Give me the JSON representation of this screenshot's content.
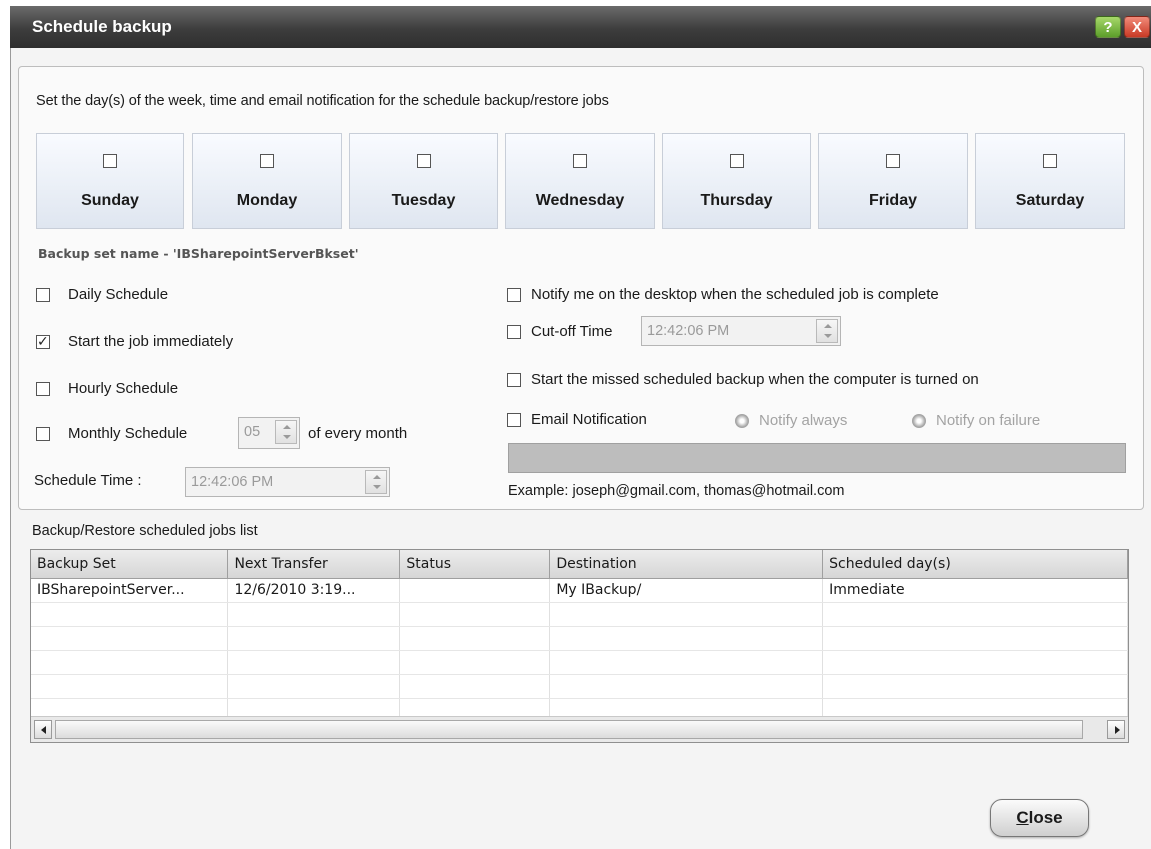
{
  "window": {
    "title": "Schedule backup",
    "help_label": "?",
    "close_label": "X"
  },
  "instruction": "Set the day(s) of the week, time and email notification for the schedule backup/restore jobs",
  "days": [
    {
      "label": "Sunday",
      "checked": false
    },
    {
      "label": "Monday",
      "checked": false
    },
    {
      "label": "Tuesday",
      "checked": false
    },
    {
      "label": "Wednesday",
      "checked": false
    },
    {
      "label": "Thursday",
      "checked": false
    },
    {
      "label": "Friday",
      "checked": false
    },
    {
      "label": "Saturday",
      "checked": false
    }
  ],
  "backup_set_name": "Backup set name - 'IBSharepointServerBkset'",
  "left_options": {
    "daily": {
      "label": "Daily Schedule",
      "checked": false
    },
    "immediate": {
      "label": "Start the job immediately",
      "checked": true
    },
    "hourly": {
      "label": "Hourly Schedule",
      "checked": false
    },
    "monthly": {
      "label": "Monthly Schedule",
      "checked": false,
      "day_value": "05",
      "suffix": "of every month"
    },
    "schedule_time": {
      "label": "Schedule Time :",
      "value": "12:42:06 PM"
    }
  },
  "right_options": {
    "notify_desktop": {
      "label": "Notify me on the desktop when the scheduled job is complete",
      "checked": false
    },
    "cutoff": {
      "label": "Cut-off Time",
      "checked": false,
      "value": "12:42:06 PM"
    },
    "missed": {
      "label": "Start the missed scheduled backup when the computer is turned on",
      "checked": false
    },
    "email": {
      "label": "Email Notification",
      "checked": false,
      "notify_always": "Notify always",
      "notify_failure": "Notify on failure",
      "value": ""
    },
    "example": "Example: joseph@gmail.com, thomas@hotmail.com"
  },
  "jobs_list": {
    "label": "Backup/Restore scheduled jobs list",
    "columns": [
      "Backup Set",
      "Next Transfer",
      "Status",
      "Destination",
      "Scheduled day(s)"
    ],
    "rows": [
      [
        "IBSharepointServer...",
        "12/6/2010 3:19...",
        "",
        "My IBackup/",
        "Immediate"
      ],
      [
        "",
        "",
        "",
        "",
        ""
      ],
      [
        "",
        "",
        "",
        "",
        ""
      ],
      [
        "",
        "",
        "",
        "",
        ""
      ],
      [
        "",
        "",
        "",
        "",
        ""
      ],
      [
        "",
        "",
        "",
        "",
        ""
      ]
    ]
  },
  "footer": {
    "close_first": "C",
    "close_rest": "lose"
  }
}
